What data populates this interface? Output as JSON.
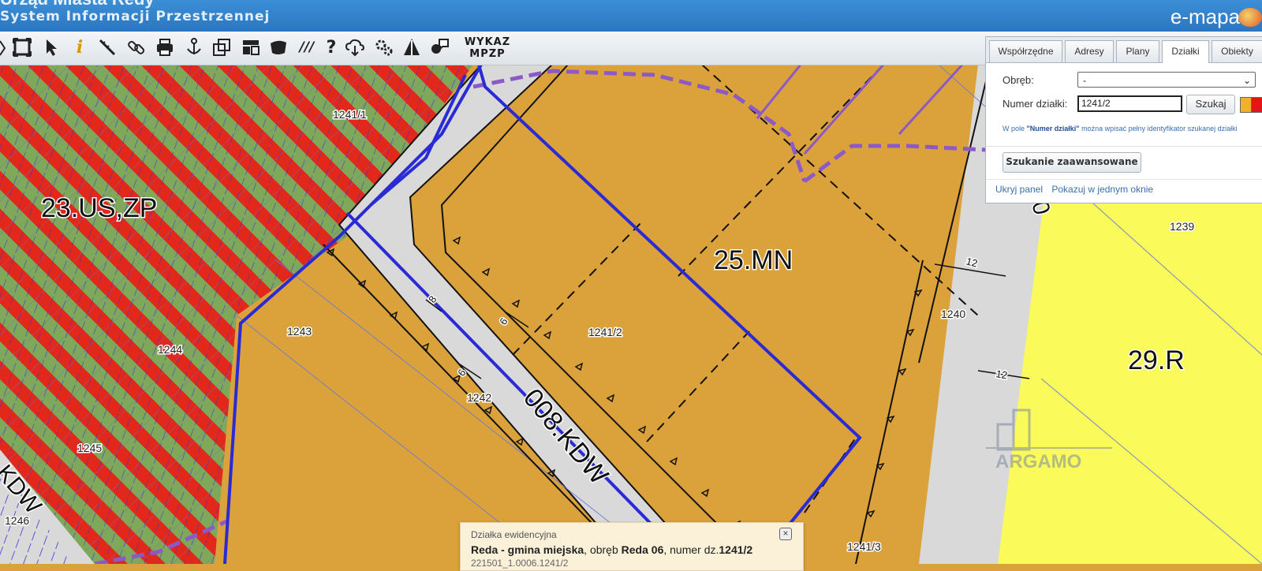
{
  "header": {
    "title_line1": "Urząd Miasta Redy",
    "title_line2": "System Informacji Przestrzennej",
    "brand": "e-mapa"
  },
  "toolbar": {
    "tools": [
      "zoom-extent-icon",
      "select-arrow-icon",
      "info-icon",
      "measure-icon",
      "link-icon",
      "print-icon",
      "anchor-icon",
      "layers-icon",
      "layout-icon",
      "shape-icon",
      "hatch-icon",
      "help-icon",
      "cloud-download-icon",
      "settings-icon",
      "triangle-icon",
      "comment-icon"
    ],
    "info_glyph": "i",
    "help_glyph": "?",
    "hatch_glyph": "///",
    "wykaz_line1": "WYKAZ",
    "wykaz_line2": "MPZP"
  },
  "panel": {
    "tabs": [
      {
        "label": "Współrzędne",
        "active": false
      },
      {
        "label": "Adresy",
        "active": false
      },
      {
        "label": "Plany",
        "active": false
      },
      {
        "label": "Działki",
        "active": true
      },
      {
        "label": "Obiekty",
        "active": false
      }
    ],
    "obreb_label": "Obręb:",
    "obreb_value": "-",
    "numer_label": "Numer działki:",
    "numer_value": "1241/2",
    "search_button": "Szukaj",
    "hint_prefix": "W pole ",
    "hint_bold": "\"Numer działki\"",
    "hint_suffix": " można wpisać pełny identyfikator szukanej działki",
    "advanced_button": "Szukanie zaawansowane",
    "link_hide": "Ukryj panel",
    "link_single": "Pokazuj w jednym oknie",
    "colors": {
      "swatch1": "#f2b12a",
      "swatch2": "#e31515"
    }
  },
  "map": {
    "zone_labels": [
      {
        "text": "23.US,ZP"
      },
      {
        "text": "25.MN"
      },
      {
        "text": "29.R"
      },
      {
        "text": "008.KDW"
      },
      {
        "text": "KDW"
      },
      {
        "text": "0"
      }
    ],
    "parcel_labels": [
      "1241/1",
      "1241/2",
      "1243",
      "1244",
      "1242",
      "1245",
      "1246",
      "1240",
      "1239",
      "1241/3"
    ],
    "dimension_labels": [
      "12",
      "12",
      "6",
      "6",
      "8"
    ],
    "watermark": "ARGAMO",
    "colors": {
      "residential": "#dba13a",
      "road": "#d9d9d9",
      "agri": "#fafa5a",
      "sport_red": "#e2271b",
      "sport_green": "#7fa85a",
      "boundary": "#2b2bd6",
      "plan_line": "#8c5ac8"
    }
  },
  "popup": {
    "title": "Działka ewidencyjna",
    "place": "Reda - gmina miejska",
    "text_obreb": ", obręb ",
    "obreb": "Reda 06",
    "text_numer": ", numer dz.",
    "numer": "1241/2",
    "id": "221501_1.0006.1241/2"
  }
}
